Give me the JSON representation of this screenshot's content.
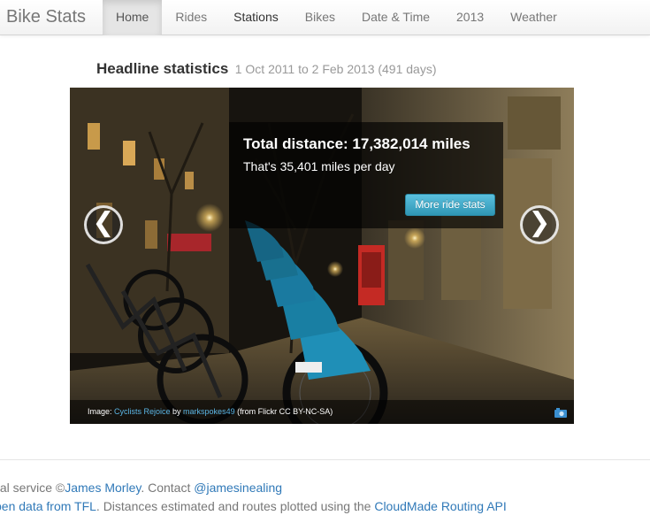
{
  "navbar": {
    "brand": "Bike Stats",
    "items": [
      {
        "label": "Home"
      },
      {
        "label": "Rides"
      },
      {
        "label": "Stations"
      },
      {
        "label": "Bikes"
      },
      {
        "label": "Date & Time"
      },
      {
        "label": "2013"
      },
      {
        "label": "Weather"
      }
    ],
    "active": "Home"
  },
  "headline": {
    "title": "Headline statistics",
    "range": "1 Oct 2011 to 2 Feb 2013 (491 days)"
  },
  "carousel": {
    "caption_title": "Total distance: 17,382,014 miles",
    "caption_text": "That's 35,401 miles per day",
    "button": "More ride stats",
    "prev_glyph": "❮",
    "next_glyph": "❯",
    "credit": {
      "prefix": "Image: ",
      "photo_link": "Cyclists Rejoice",
      "by": " by ",
      "author_link": "markspokes49",
      "suffix": " (from Flickr CC BY-NC-SA)"
    },
    "camera_icon": "camera-icon"
  },
  "footer": {
    "line1_prefix": "tal service ©",
    "line1_author": "James Morley",
    "line1_mid": ". Contact ",
    "line1_handle": "@jamesinealing",
    "line2_link1": "pen data from TFL",
    "line2_mid": ". Distances estimated and routes plotted using the ",
    "line2_link2": "CloudMade Routing API"
  },
  "colors": {
    "link": "#3079b8",
    "info_button": "#49afcd",
    "bike_teal": "#2f8fb0"
  }
}
